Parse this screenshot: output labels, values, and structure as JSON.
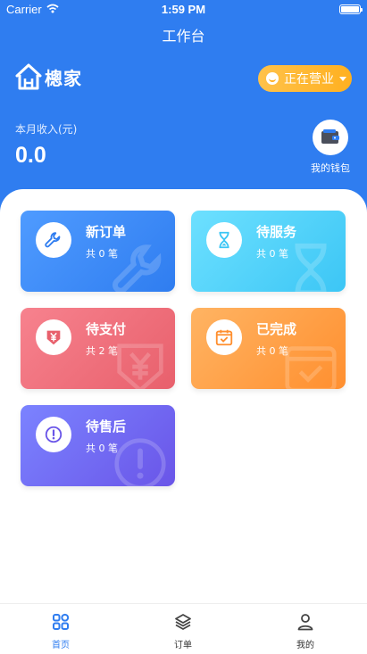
{
  "status_bar": {
    "carrier": "Carrier",
    "time": "1:59 PM"
  },
  "nav": {
    "title": "工作台"
  },
  "brand": {
    "logo_text": "樬家"
  },
  "business_status": {
    "label": "正在营业"
  },
  "income": {
    "label": "本月收入(元)",
    "value": "0.0"
  },
  "wallet": {
    "label": "我的钱包"
  },
  "cards": [
    {
      "title": "新订单",
      "count": "共 0 笔",
      "icon": "wrench-icon"
    },
    {
      "title": "待服务",
      "count": "共 0 笔",
      "icon": "hourglass-icon"
    },
    {
      "title": "待支付",
      "count": "共 2 笔",
      "icon": "yen-down-icon"
    },
    {
      "title": "已完成",
      "count": "共 0 笔",
      "icon": "calendar-check-icon"
    },
    {
      "title": "待售后",
      "count": "共 0 笔",
      "icon": "alert-icon"
    }
  ],
  "tabs": [
    {
      "label": "首页",
      "icon": "grid-icon",
      "active": true
    },
    {
      "label": "订单",
      "icon": "layers-icon",
      "active": false
    },
    {
      "label": "我的",
      "icon": "user-icon",
      "active": false
    }
  ],
  "colors": {
    "primary": "#2f7df0",
    "status_pill": "#ffb020"
  }
}
